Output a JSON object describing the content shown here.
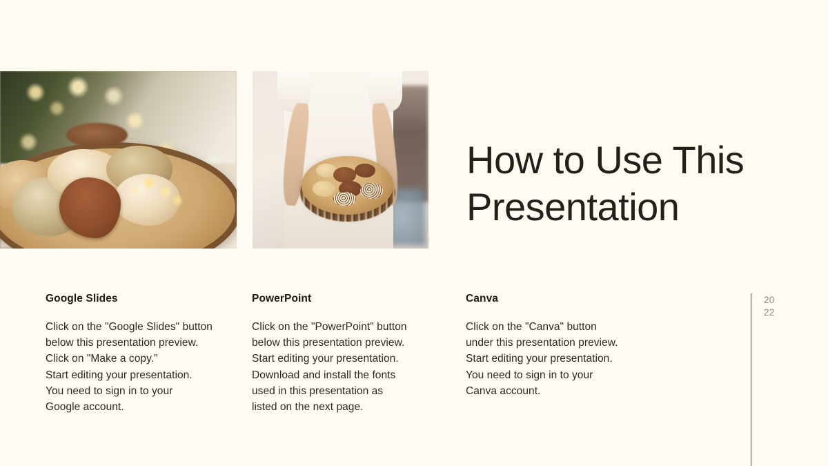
{
  "slide": {
    "background_color": "#fffbf2",
    "title": "How to Use This\nPresentation",
    "year_marker": "20\n22",
    "divider_color": "#4a453f"
  },
  "images": [
    {
      "name": "christmas-cookies-on-wood-slice",
      "alt": "Assorted Christmas cookies arranged on a round wooden slice board with bokeh fairy lights in the background"
    },
    {
      "name": "person-holding-cookie-board",
      "alt": "Person in cream clothing holding a round wooden board filled with chocolate and sprinkled cookies"
    }
  ],
  "columns": [
    {
      "heading": "Google Slides",
      "body": "Click on the \"Google Slides\" button\nbelow this presentation preview.\nClick on \"Make a copy.\"\nStart editing your presentation.\nYou need to sign in to your\nGoogle account."
    },
    {
      "heading": "PowerPoint",
      "body": "Click on the \"PowerPoint\" button\nbelow this presentation preview.\nStart editing your presentation.\nDownload and install the fonts\nused in this presentation as\nlisted on the next page."
    },
    {
      "heading": "Canva",
      "body": "Click on the \"Canva\" button\nunder this presentation preview.\nStart editing your presentation.\nYou need to sign in to your\nCanva account."
    }
  ]
}
